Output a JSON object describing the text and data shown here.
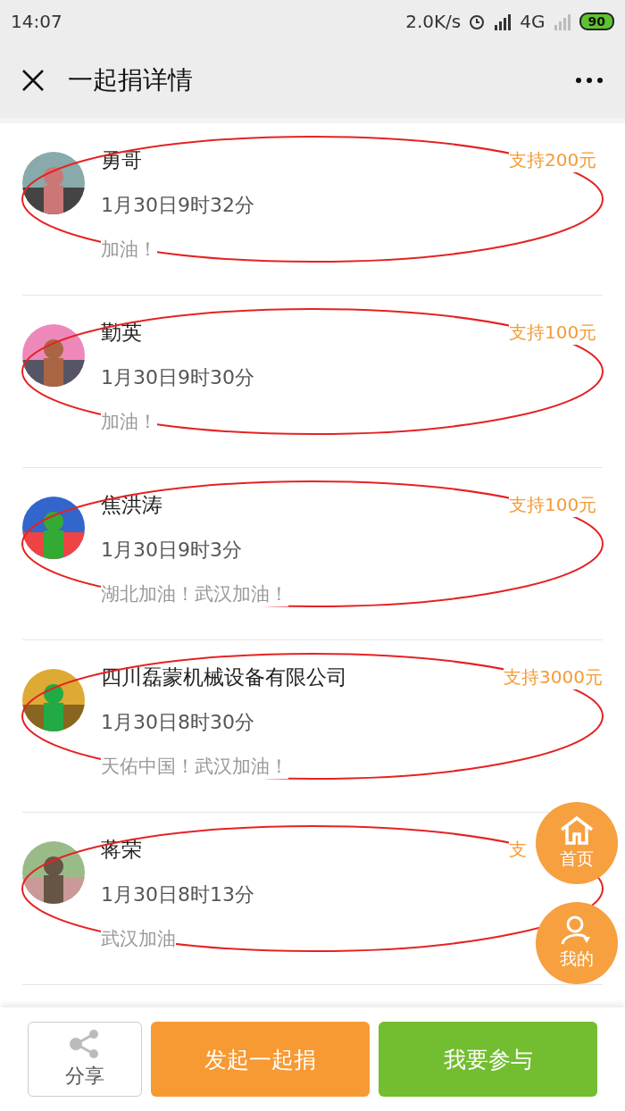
{
  "status_bar": {
    "time": "14:07",
    "network_speed": "2.0K/s",
    "network_type": "4G",
    "battery": "90"
  },
  "header": {
    "title": "一起捐详情"
  },
  "donations": [
    {
      "name": "勇哥",
      "time": "1月30日9时32分",
      "message": "加油！",
      "amount": "支持200元",
      "circled": true
    },
    {
      "name": "勤英 ",
      "time": "1月30日9时30分",
      "message": "加油！",
      "amount": "支持100元",
      "circled": true
    },
    {
      "name": "焦洪涛",
      "time": "1月30日9时3分",
      "message": "湖北加油！武汉加油！",
      "amount": "支持100元",
      "circled": true
    },
    {
      "name": "四川磊蒙机械设备有限公司",
      "time": "1月30日8时30分",
      "message": "天佑中国！武汉加油！",
      "amount": "支持3000元",
      "circled": true
    },
    {
      "name": "蒋荣",
      "time": "1月30日8时13分",
      "message": "武汉加油",
      "amount": "支",
      "circled": true
    }
  ],
  "floating_buttons": [
    {
      "kind": "home",
      "label": "首页"
    },
    {
      "kind": "profile",
      "label": "我的"
    }
  ],
  "bottom_bar": {
    "share": "分享",
    "start": "发起一起捐",
    "join": "我要参与"
  }
}
